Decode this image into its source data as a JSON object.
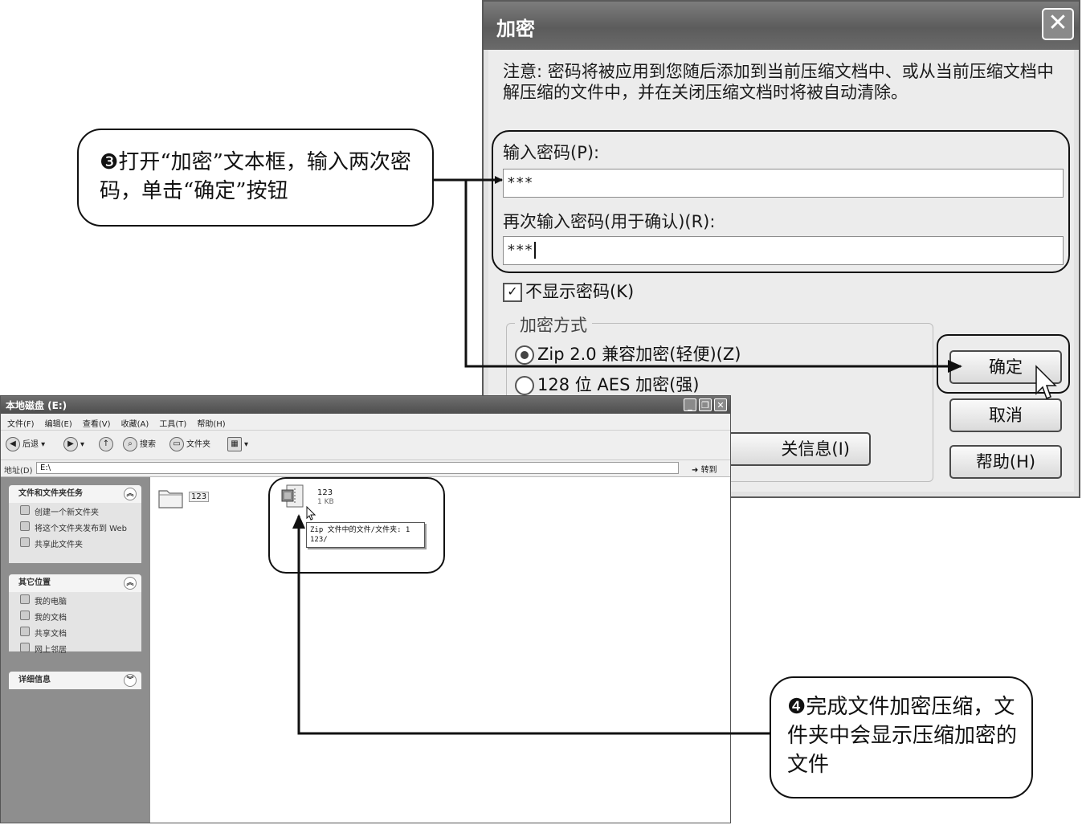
{
  "dialog": {
    "title": "加密",
    "close_glyph": "✕",
    "note": "注意: 密码将被应用到您随后添加到当前压缩文档中、或从当前压缩文档中解压缩的文件中，并在关闭压缩文档时将被自动清除。",
    "password_label": "输入密码(P):",
    "password_value": "***",
    "confirm_label": "再次输入密码(用于确认)(R):",
    "confirm_value": "***",
    "hide_password_label": "不显示密码(K)",
    "hide_password_checked": true,
    "method_group_label": "加密方式",
    "method_options": [
      {
        "label": "Zip 2.0 兼容加密(轻便)(Z)",
        "selected": true
      },
      {
        "label": "128 位 AES 加密(强)",
        "selected": false
      }
    ],
    "ok_button": "确定",
    "cancel_button": "取消",
    "help_button": "帮助(H)",
    "info_button_visible_text": "关信息(I)"
  },
  "explorer": {
    "title": "本地磁盘 (E:)",
    "menu": [
      "文件(F)",
      "编辑(E)",
      "查看(V)",
      "收藏(A)",
      "工具(T)",
      "帮助(H)"
    ],
    "toolbar": {
      "back": "后退",
      "search": "搜索",
      "folders": "文件夹"
    },
    "address_label": "地址(D)",
    "address_value": "E:\\",
    "go_label": "转到",
    "panels": {
      "tasks": {
        "title": "文件和文件夹任务",
        "items": [
          "创建一个新文件夹",
          "将这个文件夹发布到 Web",
          "共享此文件夹"
        ]
      },
      "places": {
        "title": "其它位置",
        "items": [
          "我的电脑",
          "我的文档",
          "共享文档",
          "网上邻居"
        ]
      },
      "details": {
        "title": "详细信息"
      }
    },
    "files": {
      "folder_name": "123",
      "zip_name": "123",
      "zip_size": "1 KB",
      "tooltip_line1": "Zip 文件中的文件/文件夹: 1",
      "tooltip_line2": "123/"
    }
  },
  "callouts": {
    "step3_num": "❸",
    "step3_text": "打开“加密”文本框，输入两次密码，单击“确定”按钮",
    "step4_num": "❹",
    "step4_text": "完成文件加密压缩，文件夹中会显示压缩加密的文件"
  }
}
